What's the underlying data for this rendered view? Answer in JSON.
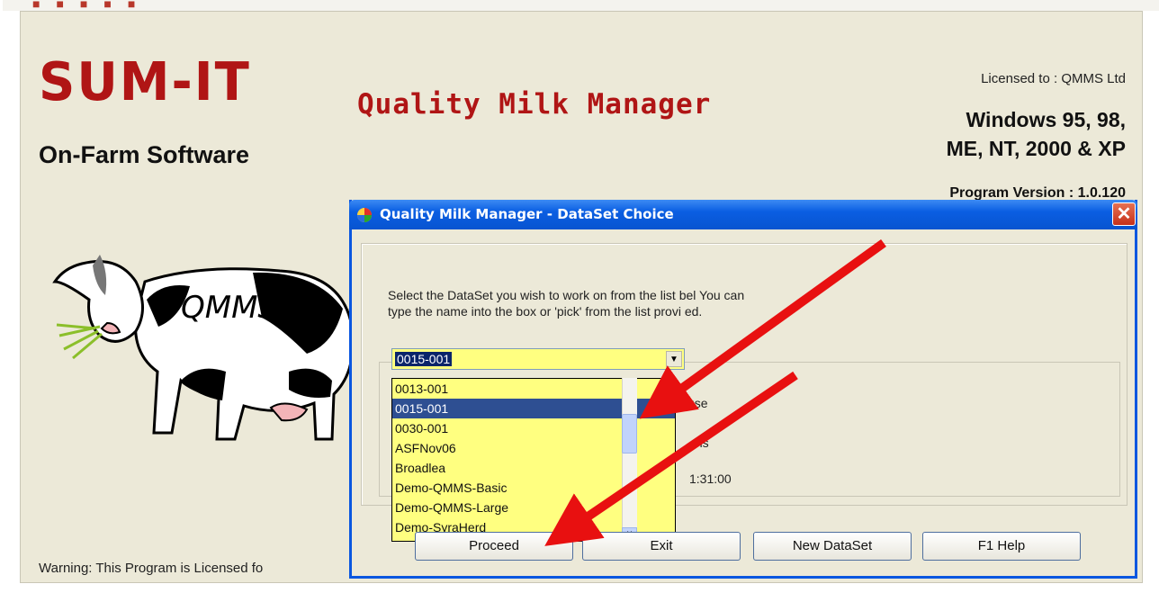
{
  "background_window": {
    "brand": "SUM-IT",
    "subtitle": "On-Farm Software",
    "product_title": "Quality Milk Manager",
    "licensed": "Licensed to : QMMS Ltd",
    "os_line1": "Windows 95, 98,",
    "os_line2": "ME, NT, 2000 & XP",
    "version": "Program Version : 1.0.120",
    "cow_label": "QMMS",
    "warning": "Warning: This Program is Licensed fo"
  },
  "dialog": {
    "title": "Quality Milk Manager - DataSet Choice",
    "close_symbol": "✕",
    "instruction_line1": "Select the DataSet you wish to work on from the list bel    You can",
    "instruction_line2": "type the name into the box or 'pick' from the list provi     ed.",
    "combo_value": "0015-001",
    "combo_arrow": "▼",
    "partial_texts": [
      "use",
      "ms",
      "1:31:00"
    ],
    "dropdown_items": [
      "0013-001",
      "0015-001",
      "0030-001",
      "ASFNov06",
      "Broadlea",
      "Demo-QMMS-Basic",
      "Demo-QMMS-Large",
      "Demo-SyraHerd"
    ],
    "selected_index": 1,
    "scroll_down_symbol": "˅",
    "buttons": {
      "proceed": "Proceed",
      "exit": "Exit",
      "new_dataset": "New DataSet",
      "help": "F1 Help"
    }
  },
  "colors": {
    "accent_red": "#b01515",
    "titlebar_blue": "#0a5ee2",
    "list_yellow": "#ffff80",
    "selection_blue": "#2e4f92",
    "arrow_red": "#e81010"
  }
}
